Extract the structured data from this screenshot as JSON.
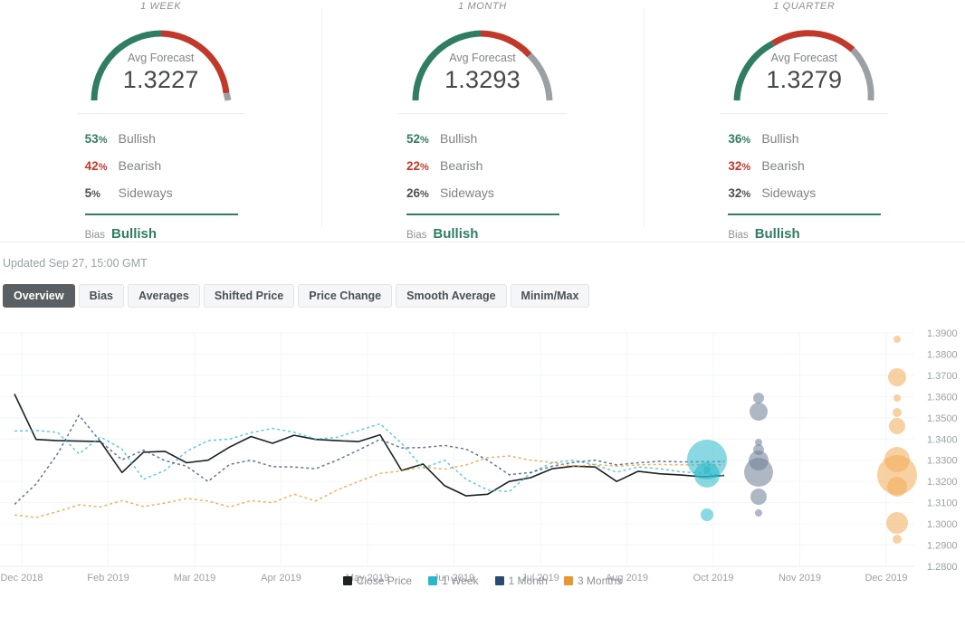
{
  "colors": {
    "bullish": "#2f7d62",
    "bearish": "#c0392b",
    "sideways": "#9aa0a4",
    "close_price": "#1c2124",
    "week": "#29b8c8",
    "month": "#2b4a6f",
    "months3": "#e8962e",
    "tab_active_bg": "#595f62",
    "grid": "#f2f5f7"
  },
  "panels": [
    {
      "title": "1 WEEK",
      "gauge": {
        "label": "Avg Forecast",
        "value": "1.3227"
      },
      "stats": [
        {
          "pct": "53",
          "unit": "%",
          "name": "Bullish",
          "kind": "bull"
        },
        {
          "pct": "42",
          "unit": "%",
          "name": "Bearish",
          "kind": "bear"
        },
        {
          "pct": "5",
          "unit": "%",
          "name": "Sideways",
          "kind": "side"
        }
      ],
      "bias_label": "Bias",
      "bias_value": "Bullish"
    },
    {
      "title": "1 MONTH",
      "gauge": {
        "label": "Avg Forecast",
        "value": "1.3293"
      },
      "stats": [
        {
          "pct": "52",
          "unit": "%",
          "name": "Bullish",
          "kind": "bull"
        },
        {
          "pct": "22",
          "unit": "%",
          "name": "Bearish",
          "kind": "bear"
        },
        {
          "pct": "26",
          "unit": "%",
          "name": "Sideways",
          "kind": "side"
        }
      ],
      "bias_label": "Bias",
      "bias_value": "Bullish"
    },
    {
      "title": "1 QUARTER",
      "gauge": {
        "label": "Avg Forecast",
        "value": "1.3279"
      },
      "stats": [
        {
          "pct": "36",
          "unit": "%",
          "name": "Bullish",
          "kind": "bull"
        },
        {
          "pct": "32",
          "unit": "%",
          "name": "Bearish",
          "kind": "bear"
        },
        {
          "pct": "32",
          "unit": "%",
          "name": "Sideways",
          "kind": "side"
        }
      ],
      "bias_label": "Bias",
      "bias_value": "Bullish"
    }
  ],
  "updated_text": "Updated Sep 27, 15:00 GMT",
  "tabs": [
    {
      "label": "Overview",
      "active": true
    },
    {
      "label": "Bias",
      "active": false
    },
    {
      "label": "Averages",
      "active": false
    },
    {
      "label": "Shifted Price",
      "active": false
    },
    {
      "label": "Price Change",
      "active": false
    },
    {
      "label": "Smooth Average",
      "active": false
    },
    {
      "label": "Minim/Max",
      "active": false
    }
  ],
  "chart_data": {
    "type": "line",
    "title": "",
    "xlabel": "",
    "ylabel": "",
    "grid": true,
    "legend_position": "bottom",
    "ylim": [
      1.28,
      1.39
    ],
    "yticks": [
      "1.3900",
      "1.3800",
      "1.3700",
      "1.3600",
      "1.3500",
      "1.3400",
      "1.3300",
      "1.3200",
      "1.3100",
      "1.3000",
      "1.2900",
      "1.2800"
    ],
    "xticks": [
      "Dec 2018",
      "Feb 2019",
      "Mar 2019",
      "Apr 2019",
      "May 2019",
      "Jun 2019",
      "Jul 2019",
      "Aug 2019",
      "Oct 2019",
      "Nov 2019",
      "Dec 2019"
    ],
    "legend": [
      {
        "name": "Close Price",
        "color": "#1c2124"
      },
      {
        "name": "1 Week",
        "color": "#29b8c8"
      },
      {
        "name": "1 Month",
        "color": "#2b4a6f"
      },
      {
        "name": "3 Months",
        "color": "#e8962e"
      }
    ],
    "series": [
      {
        "name": "Close Price",
        "color": "#1c2124",
        "style": "solid",
        "values": [
          1.3612,
          1.3398,
          1.3392,
          1.339,
          1.3388,
          1.3242,
          1.3338,
          1.3342,
          1.3288,
          1.33,
          1.3362,
          1.3412,
          1.338,
          1.3418,
          1.3398,
          1.3392,
          1.3388,
          1.342,
          1.3252,
          1.3282,
          1.318,
          1.3132,
          1.314,
          1.32,
          1.3218,
          1.326,
          1.3272,
          1.3268,
          1.32,
          1.3248,
          1.3236,
          1.323,
          1.3222,
          1.3228
        ]
      },
      {
        "name": "1 Week",
        "color": "#29b8c8",
        "style": "dotted",
        "values": [
          1.3438,
          1.344,
          1.3432,
          1.333,
          1.341,
          1.3352,
          1.321,
          1.3252,
          1.3342,
          1.3392,
          1.34,
          1.343,
          1.345,
          1.3432,
          1.34,
          1.3408,
          1.344,
          1.3472,
          1.338,
          1.3262,
          1.33,
          1.321,
          1.316,
          1.3152,
          1.324,
          1.3288,
          1.33,
          1.3278,
          1.3244,
          1.3268,
          1.326,
          1.3245,
          1.324,
          1.3227
        ]
      },
      {
        "name": "1 Month",
        "color": "#2b4a6f",
        "style": "dotted",
        "values": [
          1.3092,
          1.3188,
          1.333,
          1.3512,
          1.3388,
          1.3302,
          1.3348,
          1.3298,
          1.3272,
          1.32,
          1.328,
          1.33,
          1.327,
          1.3268,
          1.326,
          1.33,
          1.3348,
          1.3398,
          1.3358,
          1.336,
          1.337,
          1.3352,
          1.33,
          1.3232,
          1.3242,
          1.3272,
          1.329,
          1.33,
          1.3278,
          1.3288,
          1.3295,
          1.3292,
          1.3293,
          1.3293
        ]
      },
      {
        "name": "3 Months",
        "color": "#e8962e",
        "style": "dotted",
        "values": [
          1.3042,
          1.303,
          1.3058,
          1.309,
          1.308,
          1.311,
          1.3082,
          1.3098,
          1.312,
          1.3108,
          1.308,
          1.311,
          1.31,
          1.314,
          1.3108,
          1.316,
          1.32,
          1.3238,
          1.325,
          1.3268,
          1.3258,
          1.3278,
          1.3312,
          1.332,
          1.33,
          1.329,
          1.327,
          1.328,
          1.3272,
          1.3278,
          1.328,
          1.3279,
          1.3279,
          1.3279
        ]
      }
    ],
    "bubbles": [
      {
        "series": "1 Week",
        "color": "#29b8c8",
        "x": 781,
        "y": 531,
        "r": 22
      },
      {
        "series": "1 Week",
        "color": "#29b8c8",
        "x": 781,
        "y": 548,
        "r": 14
      },
      {
        "series": "1 Week",
        "color": "#29b8c8",
        "x": 781,
        "y": 542,
        "r": 4
      },
      {
        "series": "1 Week",
        "color": "#29b8c8",
        "x": 781,
        "y": 592,
        "r": 7
      },
      {
        "series": "1 Month",
        "color": "#6b7d96",
        "x": 838,
        "y": 545,
        "r": 16
      },
      {
        "series": "1 Month",
        "color": "#6b7d96",
        "x": 838,
        "y": 532,
        "r": 11
      },
      {
        "series": "1 Month",
        "color": "#6b7d96",
        "x": 838,
        "y": 520,
        "r": 6
      },
      {
        "series": "1 Month",
        "color": "#6b7d96",
        "x": 838,
        "y": 512,
        "r": 4
      },
      {
        "series": "1 Month",
        "color": "#6b7d96",
        "x": 838,
        "y": 572,
        "r": 9
      },
      {
        "series": "1 Month",
        "color": "#6b7d96",
        "x": 838,
        "y": 590,
        "r": 4
      },
      {
        "series": "1 Month",
        "color": "#6b7d96",
        "x": 838,
        "y": 478,
        "r": 10
      },
      {
        "series": "1 Month",
        "color": "#6b7d96",
        "x": 838,
        "y": 463,
        "r": 6
      },
      {
        "series": "3 Months",
        "color": "#f2ab55",
        "x": 991,
        "y": 548,
        "r": 22
      },
      {
        "series": "3 Months",
        "color": "#f2ab55",
        "x": 991,
        "y": 531,
        "r": 14
      },
      {
        "series": "3 Months",
        "color": "#f2ab55",
        "x": 991,
        "y": 561,
        "r": 11
      },
      {
        "series": "3 Months",
        "color": "#f2ab55",
        "x": 991,
        "y": 601,
        "r": 12
      },
      {
        "series": "3 Months",
        "color": "#f2ab55",
        "x": 991,
        "y": 619,
        "r": 5
      },
      {
        "series": "3 Months",
        "color": "#f2ab55",
        "x": 991,
        "y": 494,
        "r": 9
      },
      {
        "series": "3 Months",
        "color": "#f2ab55",
        "x": 991,
        "y": 479,
        "r": 5
      },
      {
        "series": "3 Months",
        "color": "#f2ab55",
        "x": 991,
        "y": 463,
        "r": 4
      },
      {
        "series": "3 Months",
        "color": "#f2ab55",
        "x": 991,
        "y": 440,
        "r": 10
      },
      {
        "series": "3 Months",
        "color": "#f2ab55",
        "x": 991,
        "y": 398,
        "r": 4
      }
    ]
  }
}
